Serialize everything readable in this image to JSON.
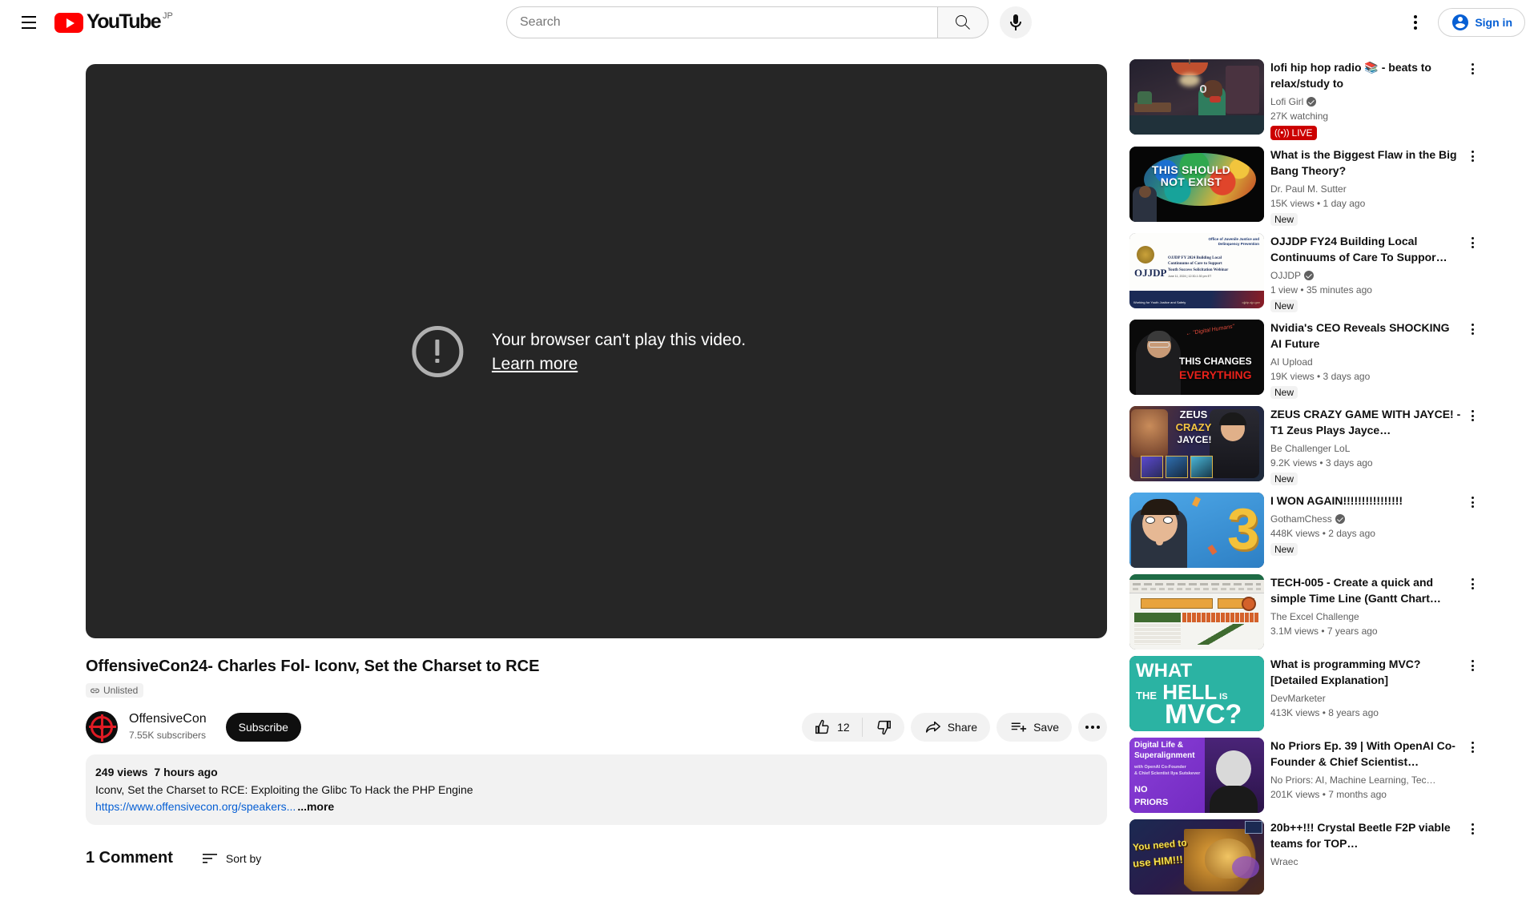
{
  "masthead": {
    "menu_label": "Guide",
    "logo_text": "YouTube",
    "logo_country": "JP",
    "search_placeholder": "Search",
    "search_value": "",
    "search_button_label": "Search",
    "mic_label": "Search with your voice",
    "settings_label": "Settings",
    "signin_label": "Sign in"
  },
  "player": {
    "error_title": "Your browser can't play this video.",
    "error_link": "Learn more"
  },
  "video": {
    "title": "OffensiveCon24- Charles Fol- Iconv, Set the Charset to RCE",
    "visibility_badge": "Unlisted",
    "channel_name": "OffensiveCon",
    "subscriber_count": "7.55K subscribers",
    "subscribe_label": "Subscribe",
    "like_count": "12",
    "share_label": "Share",
    "save_label": "Save",
    "views": "249 views",
    "published": "7 hours ago",
    "description_line1": "Iconv, Set the Charset to RCE: Exploiting the Glibc To Hack the PHP Engine",
    "description_link": "https://www.offensivecon.org/speakers...",
    "more_label": "...more"
  },
  "comments": {
    "count_label": "1 Comment",
    "sort_label": "Sort by"
  },
  "recommendations": [
    {
      "title": "lofi hip hop radio 📚 - beats to relax/study to",
      "channel": "Lofi Girl",
      "verified": true,
      "meta": "27K watching",
      "badge": "LIVE",
      "badge_type": "live",
      "thumb_style": "lofi"
    },
    {
      "title": "What is the Biggest Flaw in the Big Bang Theory?",
      "channel": "Dr. Paul M. Sutter",
      "verified": false,
      "meta": "15K views   •  1 day ago",
      "badge": "New",
      "badge_type": "new",
      "thumb_style": "bigbang",
      "thumb_text": "THIS SHOULD\nNOT EXIST"
    },
    {
      "title": "OJJDP FY24 Building Local Continuums of Care To Suppor…",
      "channel": "OJJDP",
      "verified": true,
      "meta": "1 view   •  35 minutes ago",
      "badge": "New",
      "badge_type": "new",
      "thumb_style": "ojjdp",
      "thumb_text": "OJJDP"
    },
    {
      "title": "Nvidia's CEO Reveals SHOCKING AI Future",
      "channel": "AI Upload",
      "verified": false,
      "meta": "19K views   •  3 days ago",
      "badge": "New",
      "badge_type": "new",
      "thumb_style": "nvidia",
      "thumb_text": "THIS CHANGES\nEVERYTHING"
    },
    {
      "title": "ZEUS CRAZY GAME WITH JAYCE! - T1 Zeus Plays Jayce…",
      "channel": "Be Challenger LoL",
      "verified": false,
      "meta": "9.2K views   •  3 days ago",
      "badge": "New",
      "badge_type": "new",
      "thumb_style": "zeus",
      "thumb_text": "ZEUS\nCRAZY\nJAYCE!"
    },
    {
      "title": "I WON AGAIN!!!!!!!!!!!!!!!!",
      "channel": "GothamChess",
      "verified": true,
      "meta": "448K views   •  2 days ago",
      "badge": "New",
      "badge_type": "new",
      "thumb_style": "gotham",
      "thumb_text": "3"
    },
    {
      "title": "TECH-005 - Create a quick and simple Time Line (Gantt Chart…",
      "channel": "The Excel Challenge",
      "verified": false,
      "meta": "3.1M views   •  7 years ago",
      "badge": "",
      "badge_type": "none",
      "thumb_style": "excel"
    },
    {
      "title": "What is programming MVC? [Detailed Explanation]",
      "channel": "DevMarketer",
      "verified": false,
      "meta": "413K views   •  8 years ago",
      "badge": "",
      "badge_type": "none",
      "thumb_style": "mvc",
      "thumb_text": "WHAT\nTHE HELL IS\nMVC?"
    },
    {
      "title": "No Priors Ep. 39 | With OpenAI Co-Founder & Chief Scientist…",
      "channel": "No Priors: AI, Machine Learning, Tec…",
      "verified": false,
      "meta": "201K views   •  7 months ago",
      "badge": "",
      "badge_type": "none",
      "thumb_style": "nopriors",
      "thumb_text": "Digital Life &\nSuperalignment"
    },
    {
      "title": "20b++!!! Crystal Beetle F2P viable teams for TOP…",
      "channel": "Wraec",
      "verified": false,
      "meta": "",
      "badge": "",
      "badge_type": "none",
      "thumb_style": "beetle",
      "thumb_text": "You need to\nuse HIM!!!"
    }
  ],
  "colors": {
    "brand_red": "#ff0000",
    "link_blue": "#065fd4",
    "live_red": "#cc0000",
    "player_bg": "#262626",
    "chip_bg": "#f2f2f2"
  }
}
